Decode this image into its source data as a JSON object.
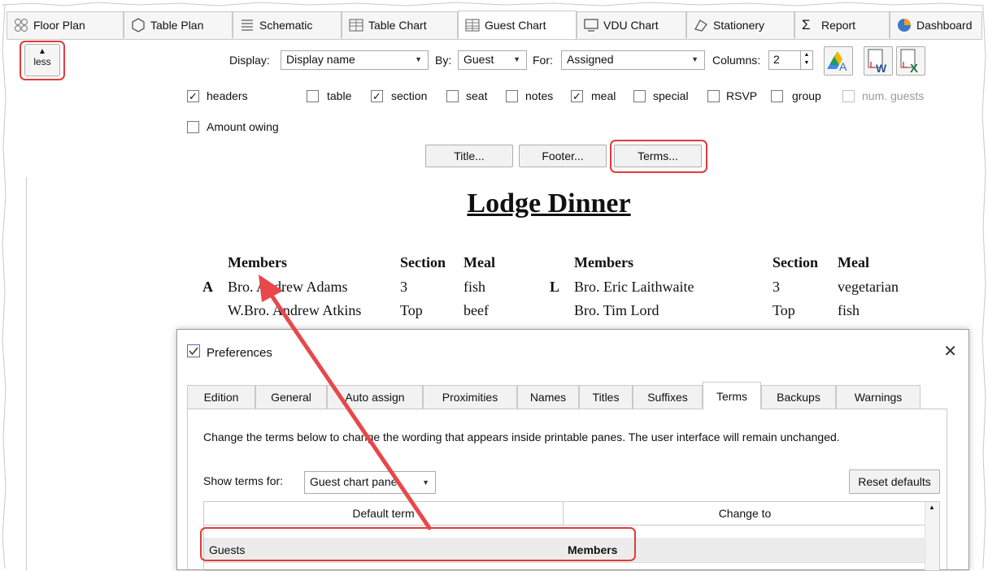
{
  "tabs": [
    {
      "label": "Floor Plan",
      "icon": "floor-plan-icon"
    },
    {
      "label": "Table Plan",
      "icon": "table-plan-icon"
    },
    {
      "label": "Schematic",
      "icon": "schematic-icon"
    },
    {
      "label": "Table Chart",
      "icon": "table-chart-icon"
    },
    {
      "label": "Guest Chart",
      "icon": "guest-chart-icon",
      "active": true
    },
    {
      "label": "VDU Chart",
      "icon": "vdu-chart-icon"
    },
    {
      "label": "Stationery",
      "icon": "stationery-icon"
    },
    {
      "label": "Report",
      "icon": "sigma-icon"
    },
    {
      "label": "Dashboard",
      "icon": "pie-icon"
    }
  ],
  "toolbar": {
    "less_label": "less",
    "display_label": "Display:",
    "display_value": "Display name",
    "by_label": "By:",
    "by_value": "Guest",
    "for_label": "For:",
    "for_value": "Assigned",
    "columns_label": "Columns:",
    "columns_value": "2"
  },
  "checkboxes": {
    "headers": {
      "label": "headers",
      "checked": "✓"
    },
    "table": {
      "label": "table",
      "checked": ""
    },
    "section": {
      "label": "section",
      "checked": "✓"
    },
    "seat": {
      "label": "seat",
      "checked": ""
    },
    "notes": {
      "label": "notes",
      "checked": ""
    },
    "meal": {
      "label": "meal",
      "checked": "✓"
    },
    "special": {
      "label": "special",
      "checked": ""
    },
    "rsvp": {
      "label": "RSVP",
      "checked": ""
    },
    "group": {
      "label": "group",
      "checked": ""
    },
    "num_guests": {
      "label": "num. guests",
      "checked": ""
    },
    "amount_owing": {
      "label": "Amount owing",
      "checked": ""
    }
  },
  "buttons": {
    "title": "Title...",
    "footer": "Footer...",
    "terms": "Terms..."
  },
  "chart": {
    "title": "Lodge Dinner",
    "columns": [
      {
        "header_name": "Members",
        "header_section": "Section",
        "header_meal": "Meal",
        "rows": [
          {
            "letter": "A",
            "name": "Bro. Andrew Adams",
            "section": "3",
            "meal": "fish"
          },
          {
            "letter": "",
            "name": "W.Bro. Andrew Atkins",
            "section": "Top",
            "meal": "beef"
          }
        ]
      },
      {
        "header_name": "Members",
        "header_section": "Section",
        "header_meal": "Meal",
        "rows": [
          {
            "letter": "L",
            "name": "Bro. Eric Laithwaite",
            "section": "3",
            "meal": "vegetarian"
          },
          {
            "letter": "",
            "name": "Bro. Tim Lord",
            "section": "Top",
            "meal": "fish"
          }
        ]
      }
    ]
  },
  "dialog": {
    "title": "Preferences",
    "close": "✕",
    "tabs": [
      "Edition",
      "General",
      "Auto assign",
      "Proximities",
      "Names",
      "Titles",
      "Suffixes",
      "Terms",
      "Backups",
      "Warnings"
    ],
    "active_tab": "Terms",
    "description": "Change the terms below to change the wording that appears inside printable panes. The user interface will remain unchanged.",
    "show_terms_label": "Show terms for:",
    "show_terms_value": "Guest chart pane",
    "reset_label": "Reset defaults",
    "grid": {
      "col_default": "Default term",
      "col_change": "Change to",
      "rows": [
        {
          "default": "Guests",
          "change": "Members"
        }
      ]
    }
  },
  "colors": {
    "highlight": "#e23a3a",
    "arrow": "#e8474b"
  }
}
